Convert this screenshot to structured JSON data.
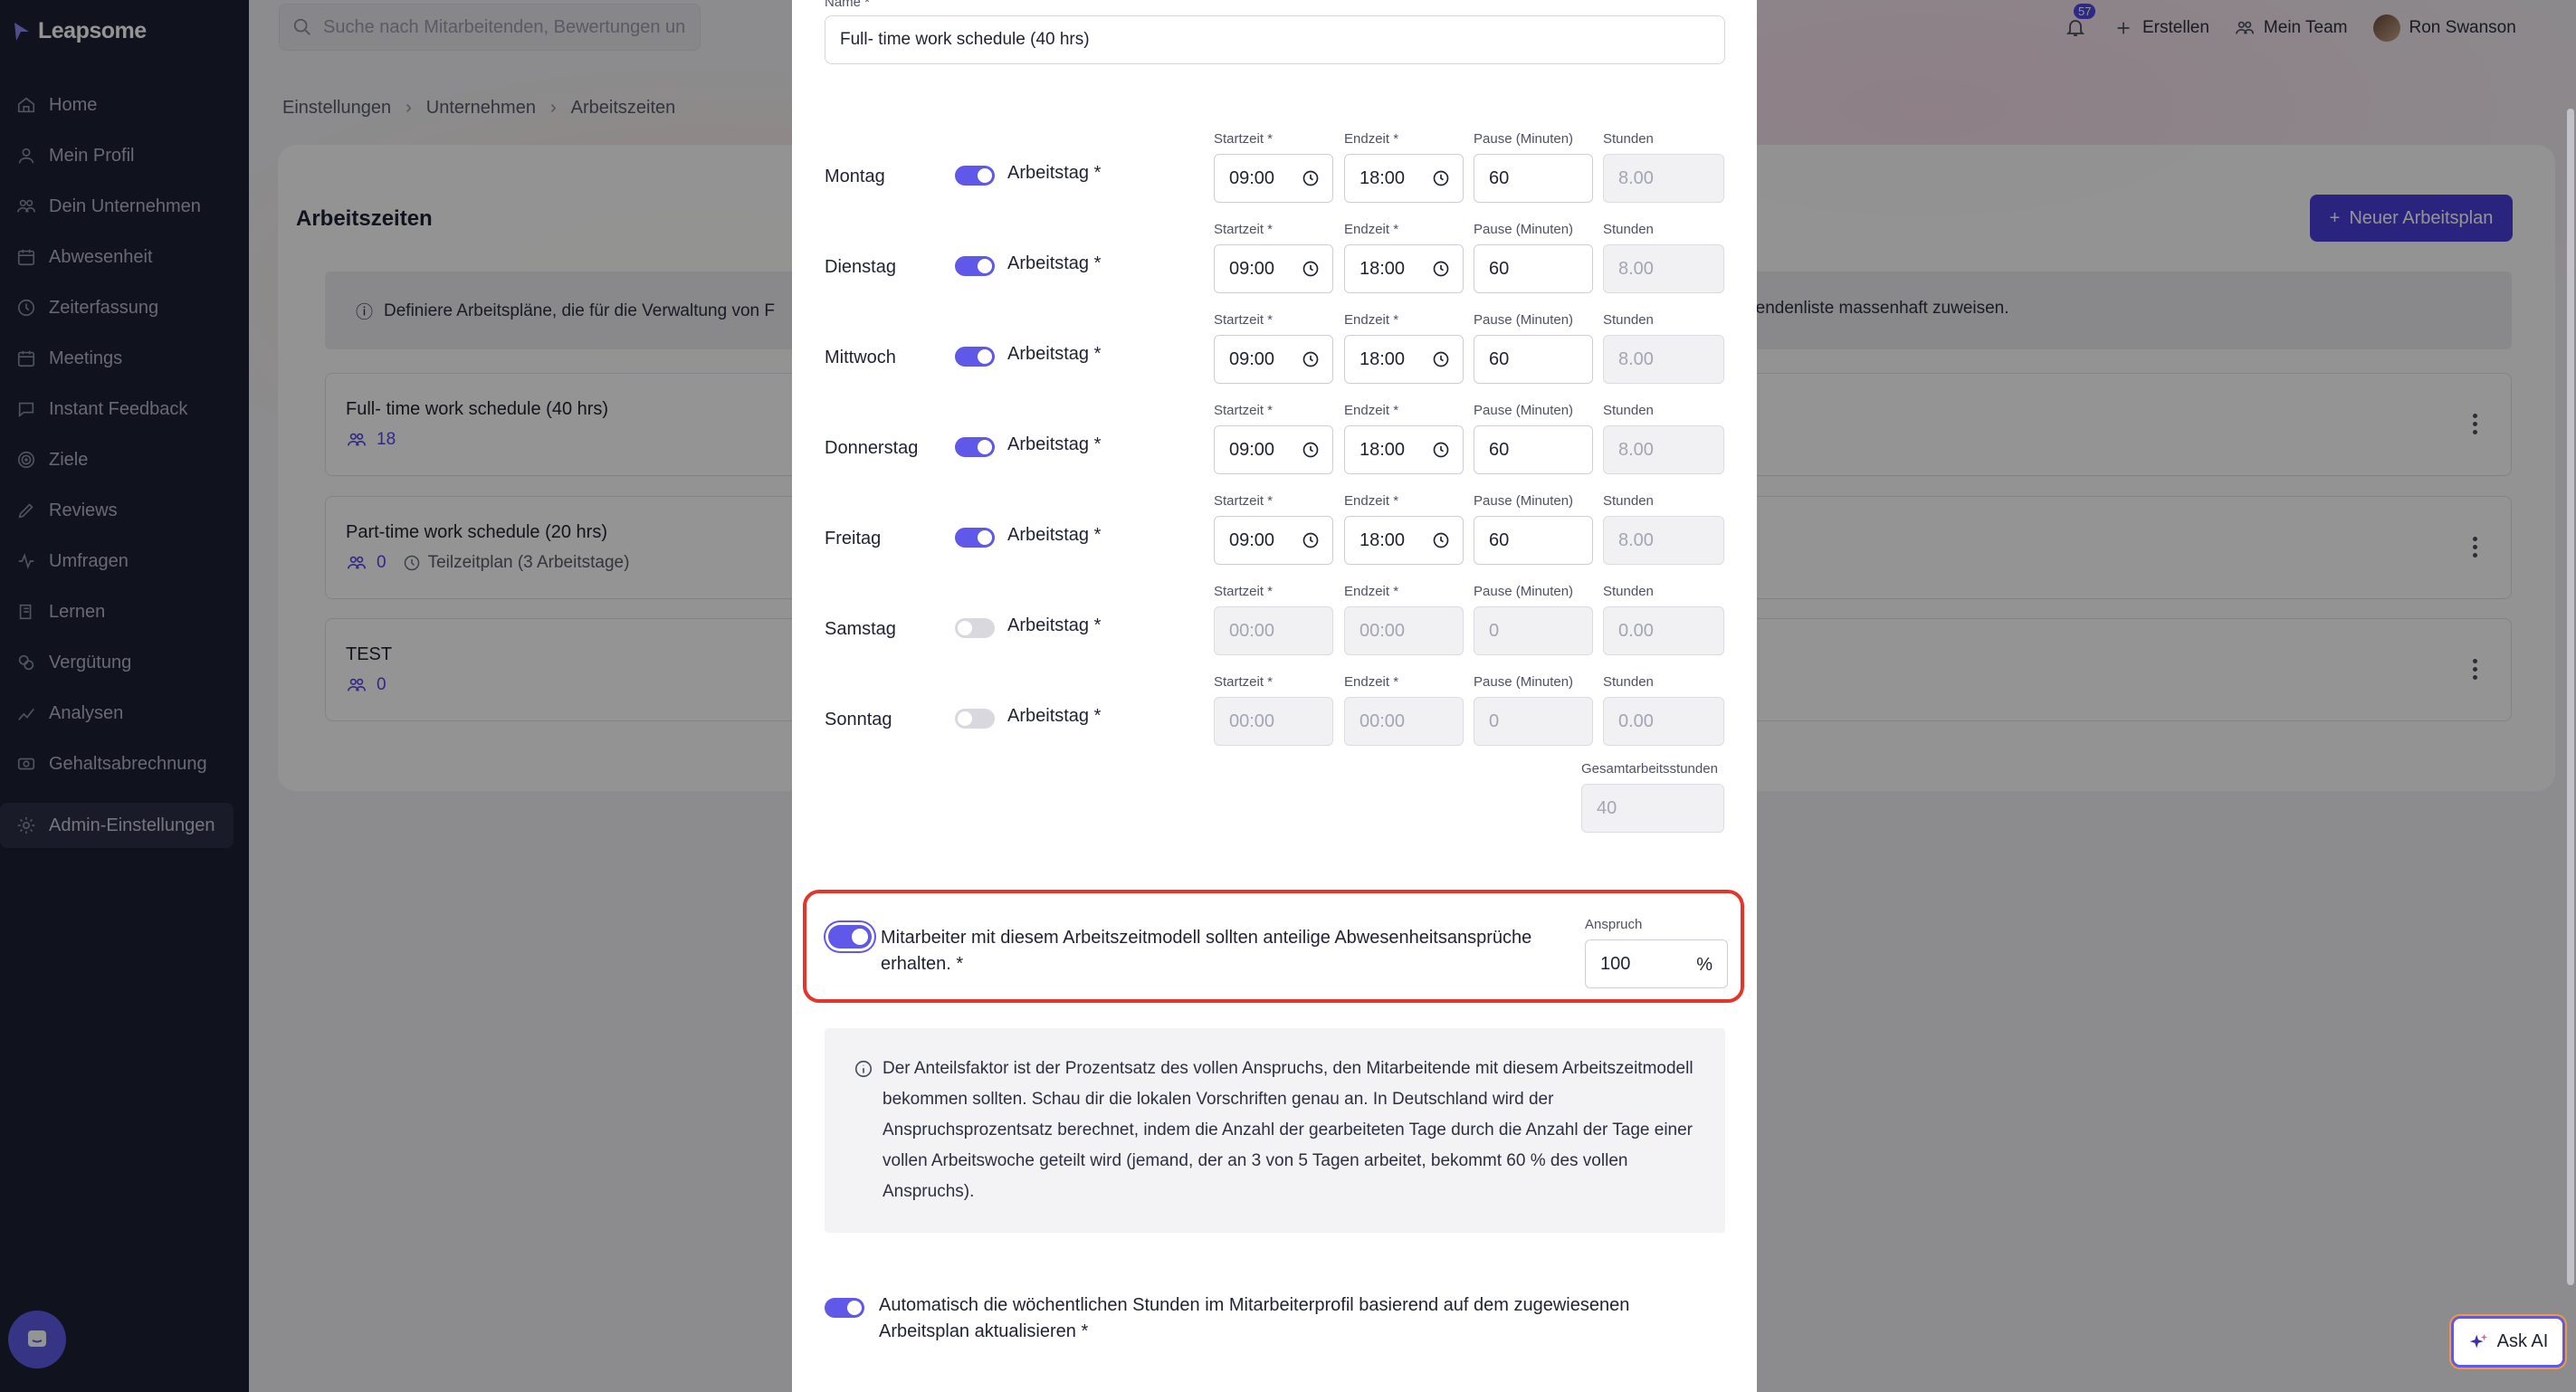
{
  "app": {
    "logo_text": "Leapsome"
  },
  "sidebar": {
    "items": [
      {
        "label": "Home",
        "icon": "home-icon"
      },
      {
        "label": "Mein Profil",
        "icon": "user-icon"
      },
      {
        "label": "Dein Unternehmen",
        "icon": "users-icon"
      },
      {
        "label": "Abwesenheit",
        "icon": "calendar-icon"
      },
      {
        "label": "Zeiterfassung",
        "icon": "clock-icon"
      },
      {
        "label": "Meetings",
        "icon": "calendar-icon"
      },
      {
        "label": "Instant Feedback",
        "icon": "chat-icon"
      },
      {
        "label": "Ziele",
        "icon": "target-icon"
      },
      {
        "label": "Reviews",
        "icon": "pen-icon"
      },
      {
        "label": "Umfragen",
        "icon": "pulse-icon"
      },
      {
        "label": "Lernen",
        "icon": "book-icon"
      },
      {
        "label": "Vergütung",
        "icon": "coins-icon"
      },
      {
        "label": "Analysen",
        "icon": "chart-icon"
      },
      {
        "label": "Gehaltsabrechnung",
        "icon": "money-icon"
      }
    ],
    "admin_label": "Admin-Einstellungen"
  },
  "topbar": {
    "search_placeholder": "Suche nach Mitarbeitenden, Bewertungen un",
    "notification_count": "57",
    "create_label": "Erstellen",
    "team_label": "Mein Team",
    "user_name": "Ron Swanson"
  },
  "breadcrumb": [
    "Einstellungen",
    "Unternehmen",
    "Arbeitszeiten"
  ],
  "page": {
    "title": "Arbeitszeiten",
    "new_plan_label": "Neuer Arbeitsplan",
    "info_left": "Definiere Arbeitspläne, die für die Verwaltung von F",
    "info_right": "beitendenliste massenhaft zuweisen.",
    "plans": [
      {
        "name": "Full- time work schedule (40 hrs)",
        "count": "18",
        "extra": ""
      },
      {
        "name": "Part-time work schedule (20 hrs)",
        "count": "0",
        "extra": "Teilzeitplan (3 Arbeitstage)"
      },
      {
        "name": "TEST",
        "count": "0",
        "extra": ""
      }
    ]
  },
  "modal": {
    "name_label": "Name *",
    "name_value": "Full- time work schedule (40 hrs)",
    "col_labels": {
      "start": "Startzeit *",
      "end": "Endzeit *",
      "pause": "Pause (Minuten)",
      "hours": "Stunden"
    },
    "workday_label": "Arbeitstag *",
    "days": [
      {
        "name": "Montag",
        "active": true,
        "start": "09:00",
        "end": "18:00",
        "pause": "60",
        "hours": "8.00"
      },
      {
        "name": "Dienstag",
        "active": true,
        "start": "09:00",
        "end": "18:00",
        "pause": "60",
        "hours": "8.00"
      },
      {
        "name": "Mittwoch",
        "active": true,
        "start": "09:00",
        "end": "18:00",
        "pause": "60",
        "hours": "8.00"
      },
      {
        "name": "Donnerstag",
        "active": true,
        "start": "09:00",
        "end": "18:00",
        "pause": "60",
        "hours": "8.00"
      },
      {
        "name": "Freitag",
        "active": true,
        "start": "09:00",
        "end": "18:00",
        "pause": "60",
        "hours": "8.00"
      },
      {
        "name": "Samstag",
        "active": false,
        "start": "00:00",
        "end": "00:00",
        "pause": "0",
        "hours": "0.00"
      },
      {
        "name": "Sonntag",
        "active": false,
        "start": "00:00",
        "end": "00:00",
        "pause": "0",
        "hours": "0.00"
      }
    ],
    "total_label": "Gesamtarbeitsstunden",
    "total_value": "40",
    "prorata_text": "Mitarbeiter mit diesem Arbeitszeitmodell sollten anteilige Abwesenheitsansprüche erhalten. *",
    "anspruch_label": "Anspruch",
    "anspruch_value": "100",
    "anspruch_unit": "%",
    "note_text": "Der Anteilsfaktor ist der Prozentsatz des vollen Anspruchs, den Mitarbeitende mit diesem Arbeitszeitmodell bekommen sollten. Schau dir die lokalen Vorschriften genau an. In Deutschland wird der Anspruchsprozentsatz berechnet, indem die Anzahl der gearbeiteten Tage durch die Anzahl der Tage einer vollen Arbeitswoche geteilt wird (jemand, der an 3 von 5 Tagen arbeitet, bekommt 60 % des vollen Anspruchs).",
    "auto_text": "Automatisch die wöchentlichen Stunden im Mitarbeiterprofil basierend auf dem zugewiesenen Arbeitsplan aktualisieren *"
  },
  "ask_ai_label": "Ask AI",
  "colors": {
    "accent": "#4b3fd9",
    "highlight": "#e5352a",
    "sidebar": "#1c1f33"
  }
}
